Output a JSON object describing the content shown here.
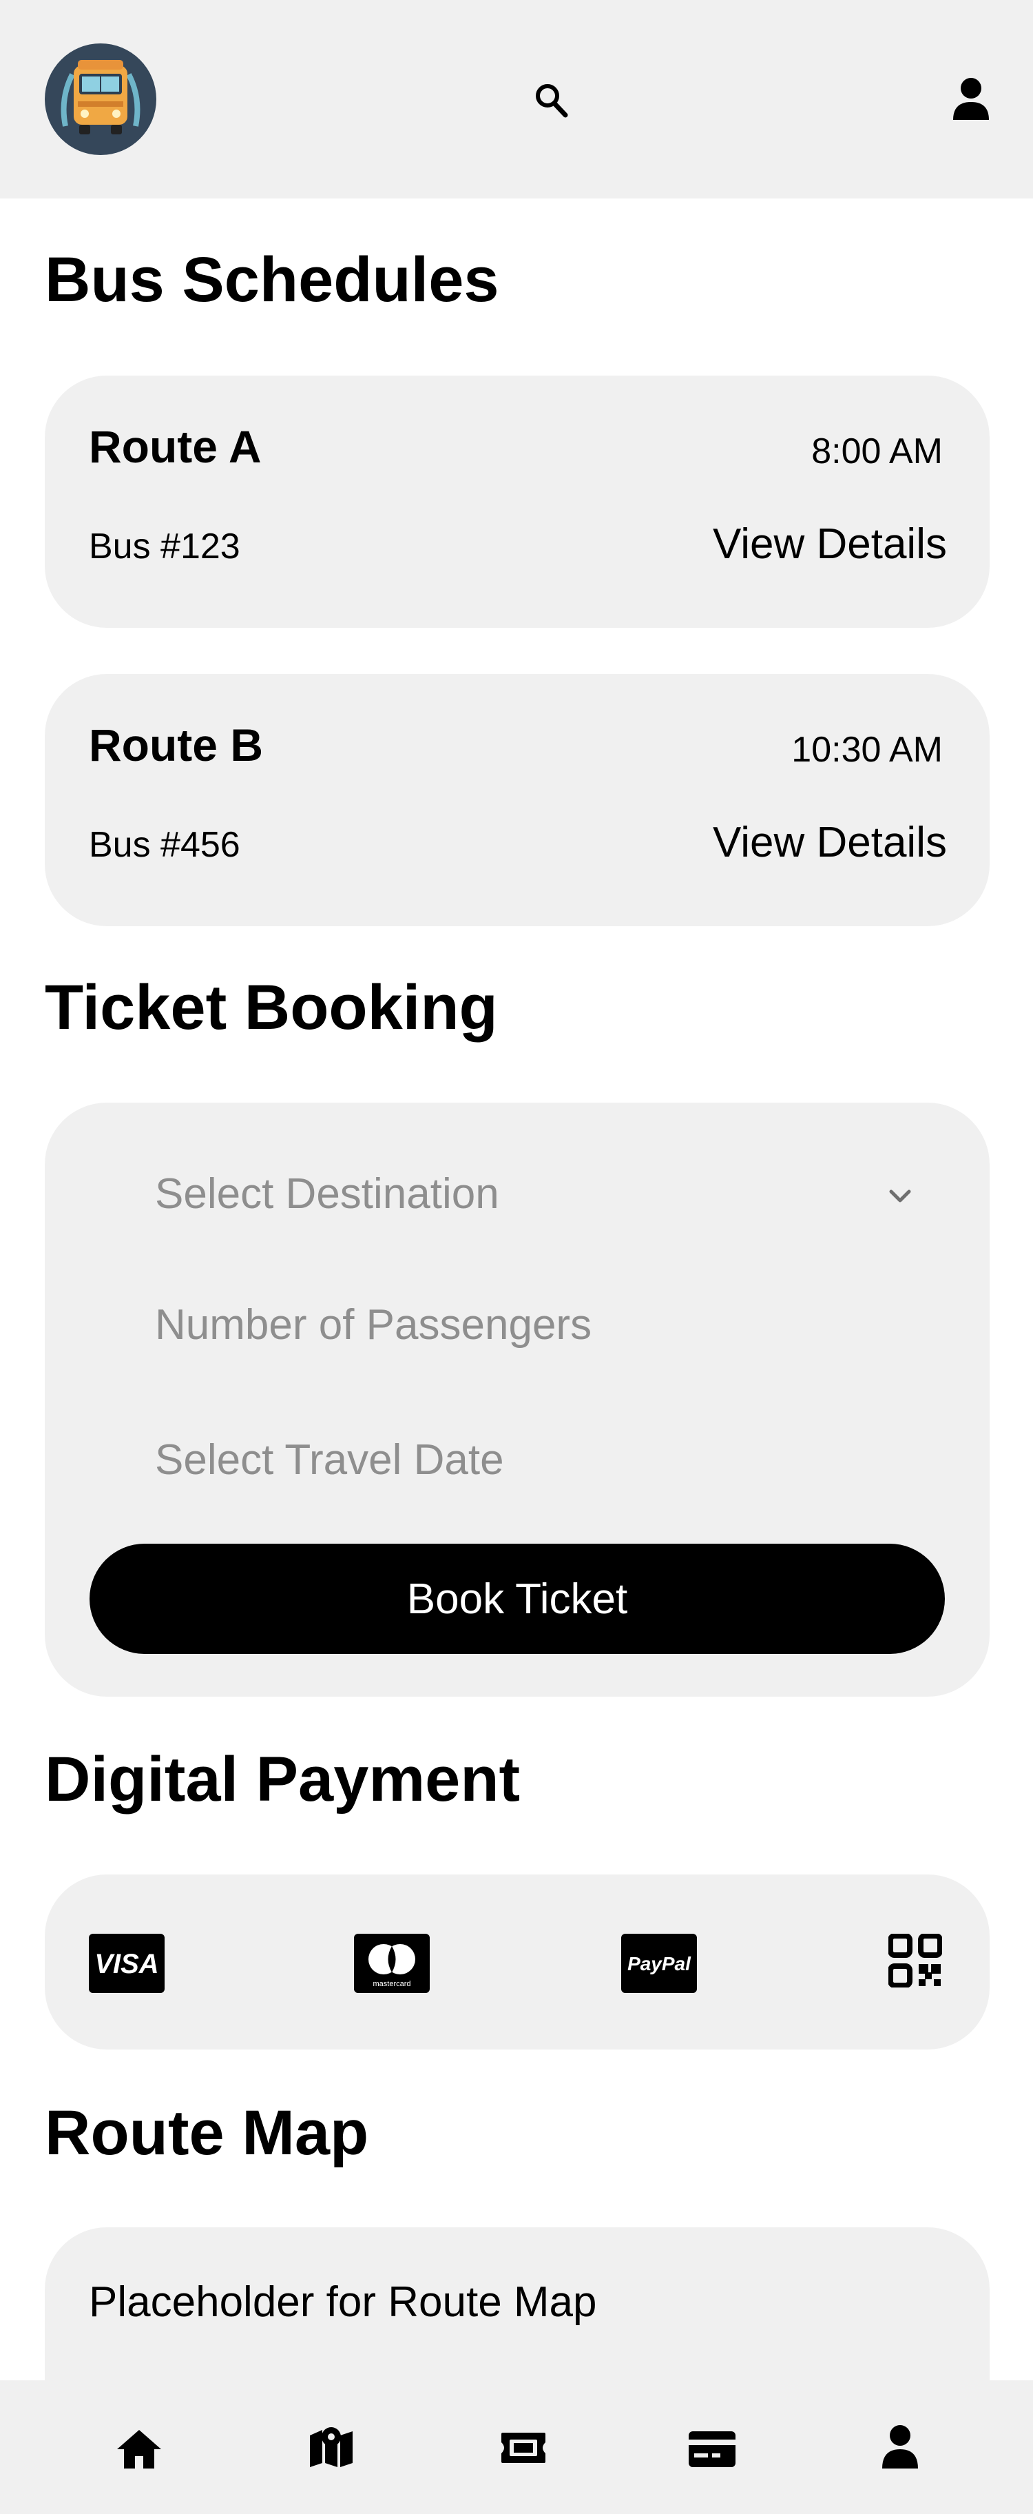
{
  "header": {
    "logo_icon": "bus-logo-icon",
    "search_icon": "search-icon",
    "profile_icon": "user-icon"
  },
  "schedules": {
    "title": "Bus Schedules",
    "routes": [
      {
        "name": "Route A",
        "time": "8:00 AM",
        "bus": "Bus #123",
        "action": "View Details"
      },
      {
        "name": "Route B",
        "time": "10:30 AM",
        "bus": "Bus #456",
        "action": "View Details"
      }
    ]
  },
  "booking": {
    "title": "Ticket Booking",
    "destination_placeholder": "Select Destination",
    "passengers_placeholder": "Number of Passengers",
    "date_placeholder": "Select Travel Date",
    "button_label": "Book Ticket"
  },
  "payment": {
    "title": "Digital Payment",
    "methods": [
      {
        "name": "Visa",
        "label": "VISA",
        "icon": "visa-icon"
      },
      {
        "name": "Mastercard",
        "label": "mastercard",
        "icon": "mastercard-icon"
      },
      {
        "name": "PayPal",
        "label": "PayPal",
        "icon": "paypal-icon"
      },
      {
        "name": "QR Code",
        "icon": "qr-code-icon"
      }
    ]
  },
  "route_map": {
    "title": "Route Map",
    "placeholder": "Placeholder for Route Map"
  },
  "bottom_nav": {
    "items": [
      {
        "name": "home",
        "icon": "home-icon"
      },
      {
        "name": "map",
        "icon": "map-icon"
      },
      {
        "name": "tickets",
        "icon": "ticket-icon"
      },
      {
        "name": "payment",
        "icon": "credit-card-icon"
      },
      {
        "name": "profile",
        "icon": "user-icon"
      }
    ]
  },
  "colors": {
    "surface": "#f0f0f0",
    "background": "#ffffff",
    "primary": "#000000",
    "placeholder_text": "#8e8e8e",
    "logo_background": "#35475a",
    "bus_yellow": "#f0a844"
  }
}
